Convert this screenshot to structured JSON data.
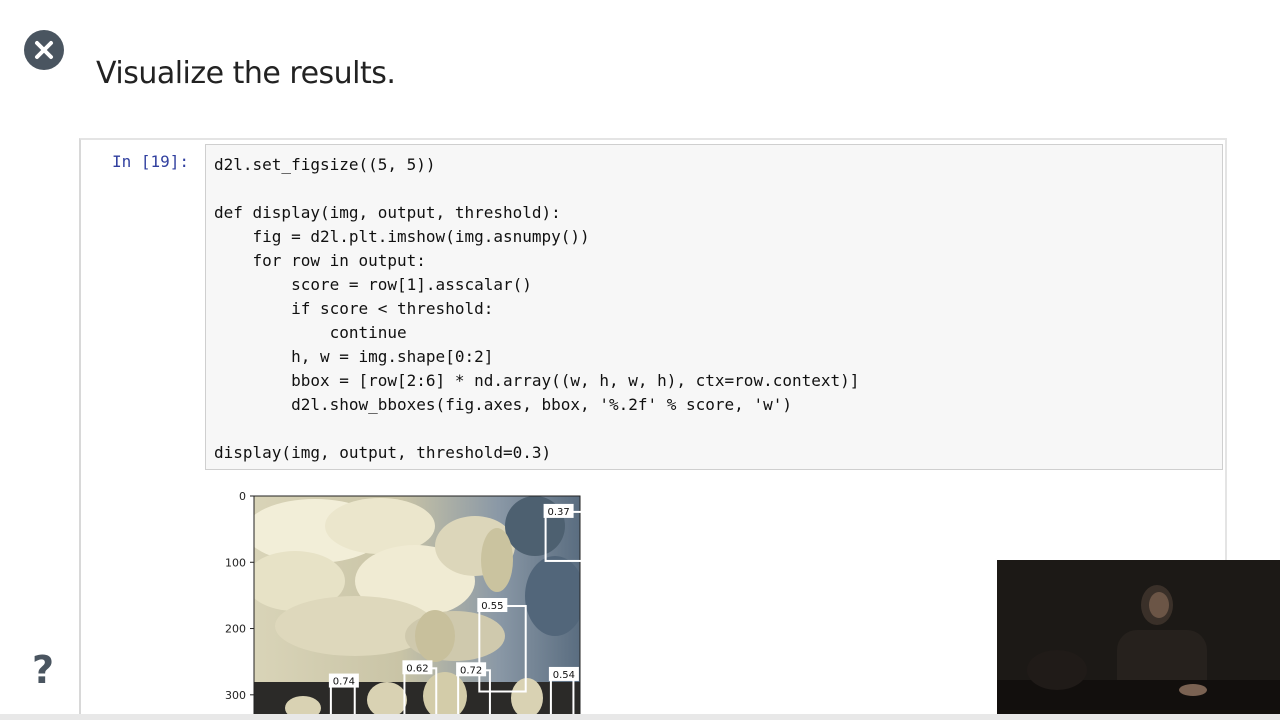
{
  "title": "Visualize the results.",
  "close_icon": "close-icon",
  "help_icon": "help-icon",
  "help_label": "?",
  "cell": {
    "prompt": "In [19]:",
    "lines": [
      "d2l.set_figsize((5, 5))",
      "",
      "def display(img, output, threshold):",
      "    fig = d2l.plt.imshow(img.asnumpy())",
      "    for row in output:",
      "        score = row[1].asscalar()",
      "        if score < threshold:",
      "            continue",
      "        h, w = img.shape[0:2]",
      "        bbox = [row[2:6] * nd.array((w, h, w, h), ctx=row.context)]",
      "        d2l.show_bboxes(fig.axes, bbox, '%.2f' % score, 'w')",
      "",
      "display(img, output, threshold=0.3)"
    ]
  },
  "figure": {
    "y_ticks": [
      "0",
      "100",
      "200",
      "300"
    ],
    "y_tick_values": [
      0,
      100,
      200,
      300
    ],
    "y_max_visible": 338,
    "boxes": [
      {
        "label": "0.37",
        "x": [
          440,
          505
        ],
        "y": [
          24,
          98
        ]
      },
      {
        "label": "0.55",
        "x": [
          340,
          410
        ],
        "y": [
          166,
          295
        ]
      },
      {
        "label": "0.62",
        "x": [
          227,
          275
        ],
        "y": [
          260,
          338
        ]
      },
      {
        "label": "0.72",
        "x": [
          308,
          356
        ],
        "y": [
          263,
          338
        ]
      },
      {
        "label": "0.54",
        "x": [
          448,
          482
        ],
        "y": [
          270,
          338
        ]
      },
      {
        "label": "0.74",
        "x": [
          116,
          152
        ],
        "y": [
          280,
          338
        ]
      }
    ]
  }
}
